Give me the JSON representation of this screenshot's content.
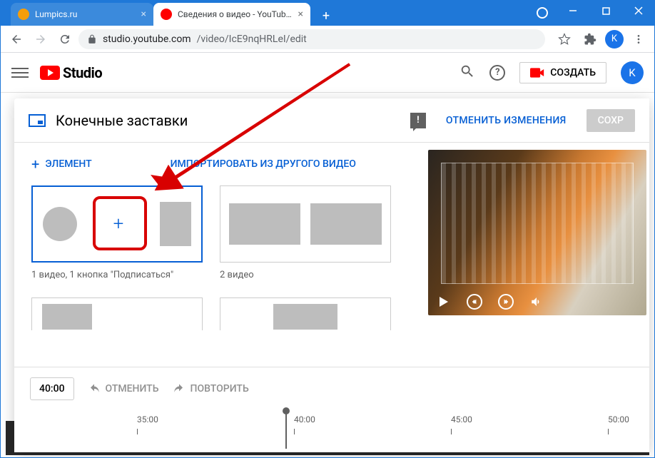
{
  "browser": {
    "tabs": [
      {
        "title": "Lumpics.ru",
        "favicon": "orange"
      },
      {
        "title": "Сведения о видео - YouTube Stu",
        "favicon": "red"
      }
    ],
    "url": {
      "domain": "studio.youtube.com",
      "path": "/video/IcE9nqHRLeI/edit"
    },
    "avatar": "K"
  },
  "yt": {
    "studio": "Studio",
    "create": "СОЗДАТЬ",
    "avatar": "K"
  },
  "editor": {
    "title": "Конечные заставки",
    "cancel": "ОТМЕНИТЬ ИЗМЕНЕНИЯ",
    "save": "СОХР",
    "element": "ЭЛЕМЕНТ",
    "import": "ИМПОРТИРОВАТЬ ИЗ ДРУГОГО ВИДЕО",
    "templates": [
      {
        "label": "1 видео, 1 кнопка \"Подписаться\""
      },
      {
        "label": "2 видео"
      }
    ]
  },
  "timeline": {
    "current": "40:00",
    "undo": "ОТМЕНИТЬ",
    "redo": "ПОВТОРИТЬ",
    "ticks": [
      "35:00",
      "40:00",
      "45:00",
      "50:00"
    ]
  }
}
